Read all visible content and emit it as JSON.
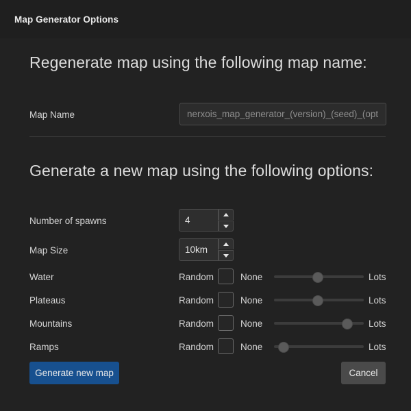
{
  "window": {
    "title": "Map Generator Options"
  },
  "sections": {
    "regenerate": {
      "heading": "Regenerate map using the following map name:",
      "map_name": {
        "label": "Map Name",
        "value": "",
        "placeholder": "nerxois_map_generator_(version)_(seed)_(options)"
      }
    },
    "generate": {
      "heading": "Generate a new map using the following options:",
      "spinners": [
        {
          "label": "Number of spawns",
          "value": "4",
          "increment_icon": "triangle-up-icon",
          "decrement_icon": "triangle-down-icon"
        },
        {
          "label": "Map Size",
          "value": "10km",
          "increment_icon": "triangle-up-icon",
          "decrement_icon": "triangle-down-icon"
        }
      ],
      "slider_rows": [
        {
          "label": "Water",
          "random_label": "Random",
          "random_checked": false,
          "min_label": "None",
          "max_label": "Lots",
          "value_percent": 48
        },
        {
          "label": "Plateaus",
          "random_label": "Random",
          "random_checked": false,
          "min_label": "None",
          "max_label": "Lots",
          "value_percent": 48
        },
        {
          "label": "Mountains",
          "random_label": "Random",
          "random_checked": false,
          "min_label": "None",
          "max_label": "Lots",
          "value_percent": 81
        },
        {
          "label": "Ramps",
          "random_label": "Random",
          "random_checked": false,
          "min_label": "None",
          "max_label": "Lots",
          "value_percent": 10
        }
      ]
    }
  },
  "footer": {
    "generate_label": "Generate new map",
    "cancel_label": "Cancel"
  },
  "colors": {
    "background": "#222222",
    "titlebar": "#1f1f1f",
    "accent_blue": "#17508f",
    "cancel_gray": "#4a4a4a",
    "text": "#d8d8d8",
    "placeholder": "#8e8e8e",
    "border": "#4c4c4c"
  }
}
